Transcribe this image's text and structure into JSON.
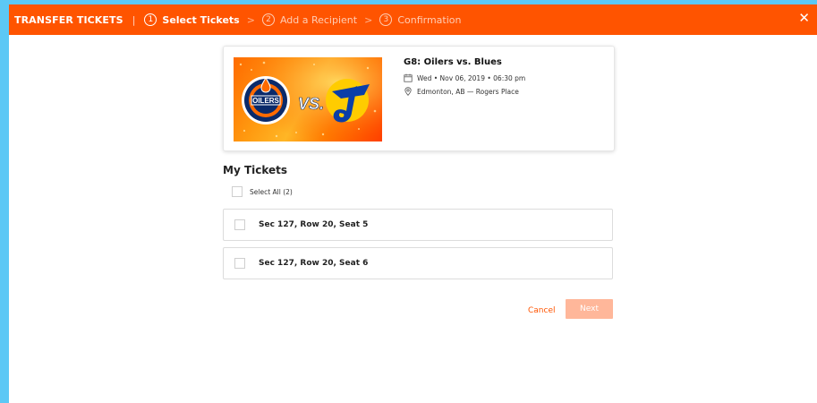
{
  "header": {
    "title": "TRANSFER TICKETS",
    "separator": "|",
    "steps": [
      {
        "num": "1",
        "label": "Select Tickets"
      },
      {
        "num": "2",
        "label": "Add a Recipient"
      },
      {
        "num": "3",
        "label": "Confirmation"
      }
    ],
    "chevron": ">",
    "close": "✕"
  },
  "event": {
    "title": "G8: Oilers vs. Blues",
    "date": "Wed • Nov 06, 2019 • 06:30 pm",
    "venue": "Edmonton, AB — Rogers Place",
    "image": {
      "home_logo_text": "OILERS",
      "vs_text": "VS."
    }
  },
  "tickets_section": {
    "title": "My Tickets",
    "select_all": "Select All (2)",
    "tickets": [
      {
        "label": "Sec 127, Row 20, Seat 5"
      },
      {
        "label": "Sec 127, Row 20, Seat 6"
      }
    ]
  },
  "actions": {
    "cancel": "Cancel",
    "next": "Next"
  },
  "colors": {
    "primary": "#ff5400",
    "next_disabled": "#ffb79a",
    "background_edge": "#5cc8f5"
  },
  "icons": {
    "calendar": "calendar-icon",
    "location": "location-pin-icon",
    "close": "close-icon"
  }
}
